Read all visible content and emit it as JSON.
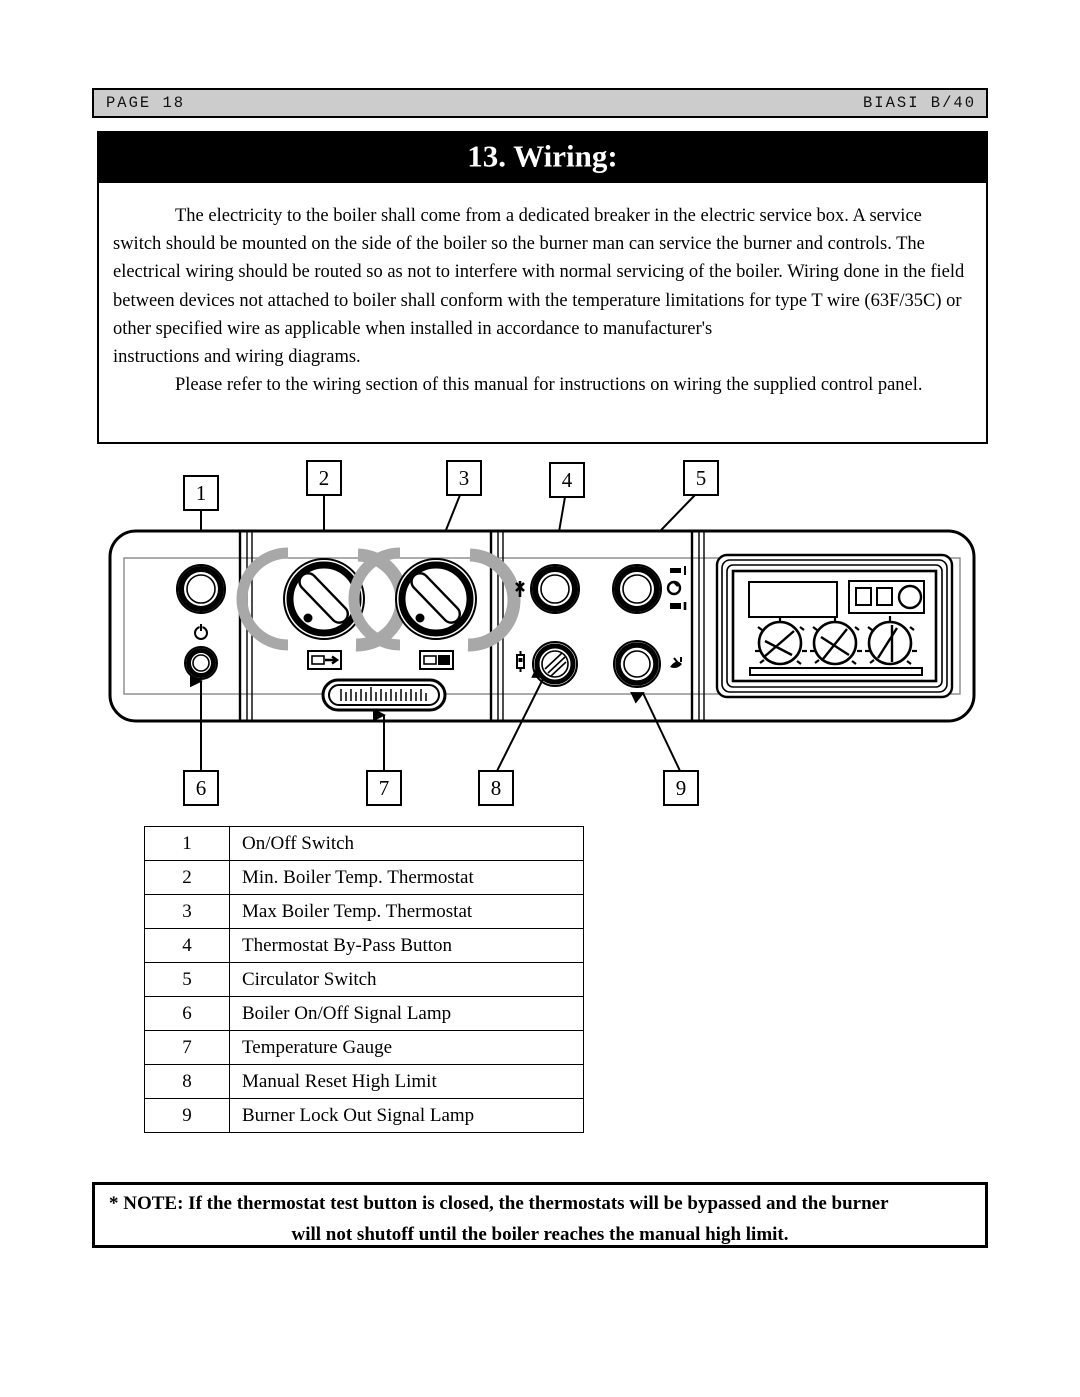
{
  "header": {
    "page_label": "PAGE 18",
    "model_label": "BIASI B/40"
  },
  "title": "13. Wiring:",
  "body": {
    "paragraph1": "The electricity to the boiler shall come from a dedicated breaker in the electric service box. A service switch should be mounted on the side of the boiler so the burner man can service the burner and controls. The electrical wiring should be routed so as not to interfere with normal servicing of the boiler. Wiring done in the field between devices not attached to boiler shall conform with the temperature limitations for type T wire (63F/35C) or other specified wire as applicable when installed in accordance to manufacturer's",
    "paragraph1b": "instructions and wiring diagrams.",
    "paragraph2": "Please refer to the wiring section of this manual for instructions on wiring the supplied control panel."
  },
  "diagram": {
    "callouts_top": [
      "1",
      "2",
      "3",
      "4",
      "5"
    ],
    "callouts_bottom": [
      "6",
      "7",
      "8",
      "9"
    ],
    "panel_icons": {
      "power_symbol": "power-symbol",
      "min_thermostat_icon": "min-temp-icon",
      "max_thermostat_icon": "max-temp-icon",
      "bypass_icon": "bypass-icon",
      "circulator_icon": "circulator-icon",
      "reset_icon": "reset-icon",
      "lockout_icon": "lockout-icon"
    }
  },
  "legend": {
    "rows": [
      {
        "num": "1",
        "label": "On/Off Switch"
      },
      {
        "num": "2",
        "label": "Min. Boiler Temp. Thermostat"
      },
      {
        "num": "3",
        "label": "Max Boiler Temp. Thermostat"
      },
      {
        "num": "4",
        "label": "Thermostat By-Pass Button"
      },
      {
        "num": "5",
        "label": "Circulator Switch"
      },
      {
        "num": "6",
        "label": "Boiler On/Off Signal Lamp"
      },
      {
        "num": "7",
        "label": "Temperature Gauge"
      },
      {
        "num": "8",
        "label": "Manual Reset High Limit"
      },
      {
        "num": "9",
        "label": "Burner Lock Out Signal Lamp"
      }
    ]
  },
  "note": {
    "line1": "* NOTE: If the thermostat test button is closed, the thermostats will be bypassed and the burner",
    "line2": "will not shutoff until the boiler reaches the manual high limit."
  },
  "colors": {
    "header_bg": "#cccccc",
    "title_bg": "#000000",
    "title_fg": "#ffffff",
    "knob_accent": "#a8a8a8",
    "page_bg": "#ffffff"
  }
}
